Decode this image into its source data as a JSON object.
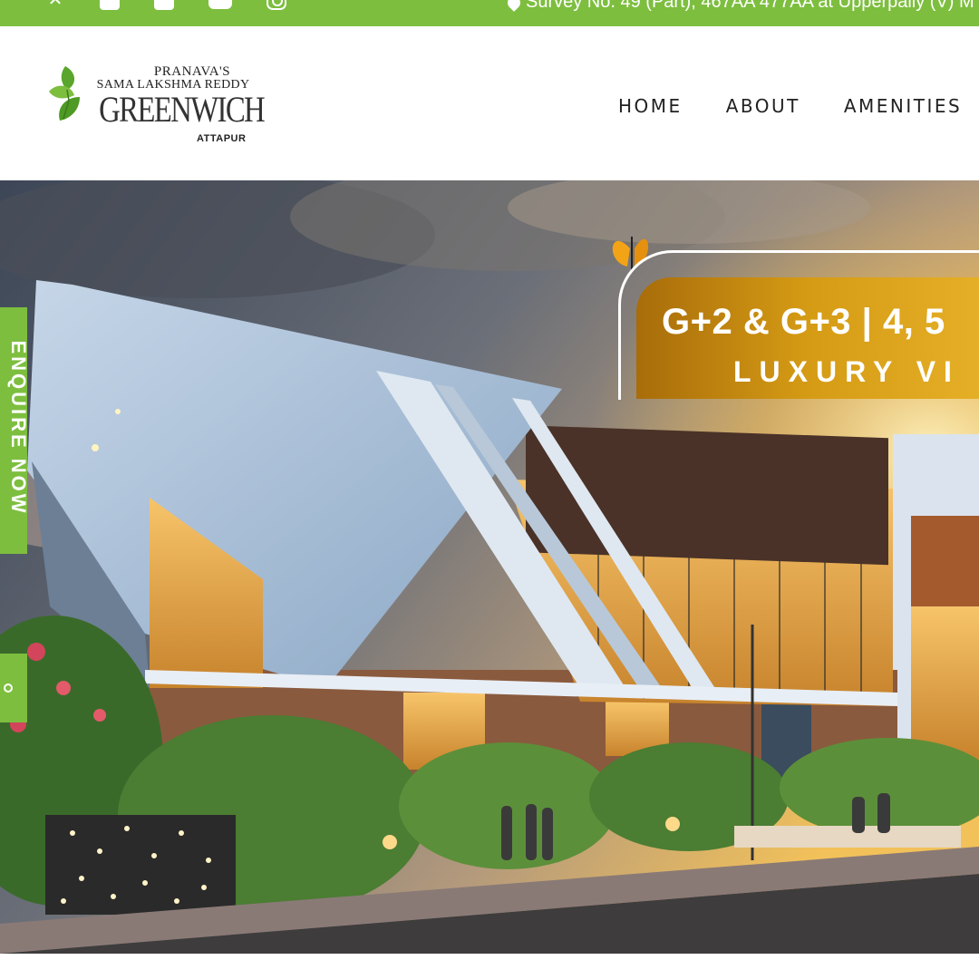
{
  "topbar": {
    "social": [
      "x-icon",
      "facebook-icon",
      "linkedin-icon",
      "youtube-icon",
      "instagram-icon"
    ],
    "address": "Survey No. 49 (Part), 467AA 477AA at Upperpally (V) M"
  },
  "logo": {
    "line1": "PRANAVA'S",
    "line2": "SAMA LAKSHMA REDDY",
    "name": "GREENWICH",
    "location": "ATTAPUR"
  },
  "nav": {
    "items": [
      "HOME",
      "ABOUT",
      "AMENITIES"
    ]
  },
  "hero": {
    "banner_line1": "G+2 & G+3  |  4, 5",
    "banner_line2": "LUXURY VI"
  },
  "sidebar": {
    "enquire_label": "ENQUIRE NOW"
  },
  "colors": {
    "brand_green": "#7dbe3f",
    "banner_gold": "#d59b14"
  }
}
